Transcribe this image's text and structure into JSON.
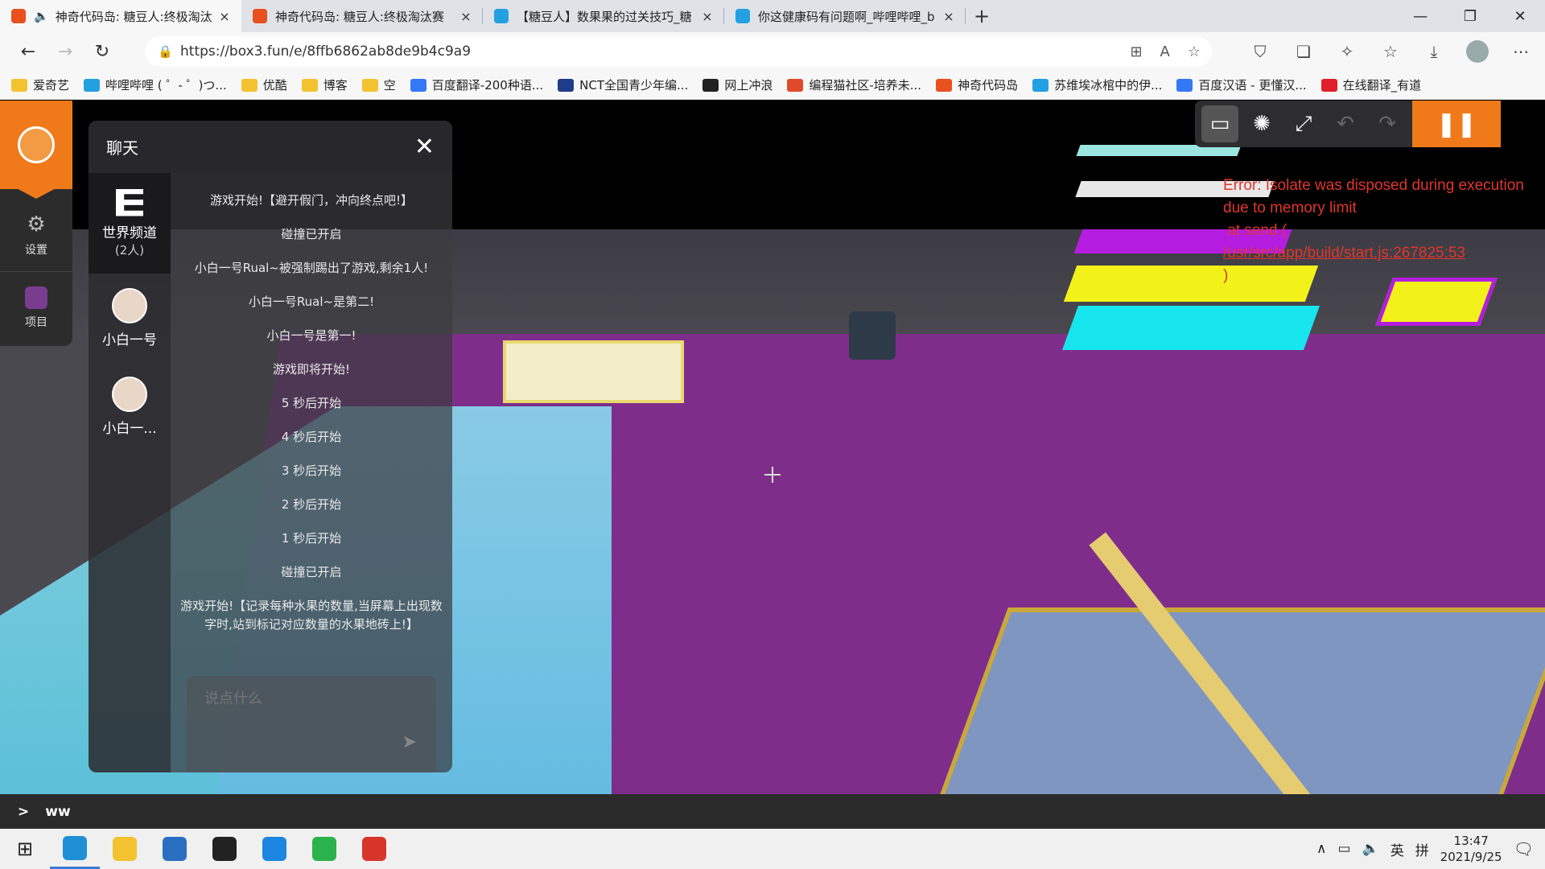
{
  "tabs": [
    {
      "title": "神奇代码岛: 糖豆人:终极淘汰",
      "close": "×",
      "fav_color": "#e8501e",
      "active": true
    },
    {
      "title": "神奇代码岛: 糖豆人:终极淘汰赛",
      "close": "×",
      "fav_color": "#e8501e"
    },
    {
      "title": "【糖豆人】数果果的过关技巧_糖",
      "close": "×",
      "fav_color": "#23a0e0"
    },
    {
      "title": "你这健康码有问题啊_哔哩哔哩_b",
      "close": "×",
      "fav_color": "#23a0e0"
    }
  ],
  "new_tab": "+",
  "address": {
    "url": "https://box3.fun/e/8ffb6862ab8de9b4c9a9"
  },
  "bookmarks": [
    {
      "label": "爱奇艺",
      "color": "#f2c230"
    },
    {
      "label": "哔哩哔哩 ( ゜- ゜)つ...",
      "color": "#23a0e0"
    },
    {
      "label": "优酷",
      "color": "#f2c230"
    },
    {
      "label": "博客",
      "color": "#f2c230"
    },
    {
      "label": "空",
      "color": "#f2c230"
    },
    {
      "label": "百度翻译-200种语...",
      "color": "#3478f6"
    },
    {
      "label": "NCT全国青少年编...",
      "color": "#1f3c8a"
    },
    {
      "label": "网上冲浪",
      "color": "#222222"
    },
    {
      "label": "编程猫社区-培养未...",
      "color": "#e04a2a"
    },
    {
      "label": "神奇代码岛",
      "color": "#e8501e"
    },
    {
      "label": "苏维埃冰棺中的伊...",
      "color": "#23a0e0"
    },
    {
      "label": "百度汉语 - 更懂汉...",
      "color": "#3478f6"
    },
    {
      "label": "在线翻译_有道",
      "color": "#e0202a"
    }
  ],
  "sidenav": {
    "settings_label": "设置",
    "project_label": "项目"
  },
  "chat": {
    "title": "聊天",
    "close": "✕",
    "channels": [
      {
        "name": "世界频道",
        "sub": "(2人)"
      },
      {
        "name": "小白一号"
      },
      {
        "name": "小白一..."
      }
    ],
    "messages": [
      "游戏开始!【避开假门，冲向终点吧!】",
      "碰撞已开启",
      "小白一号Rual~被强制踢出了游戏,剩余1人!",
      "小白一号Rual~是第二!",
      "小白一号是第一!",
      "游戏即将开始!",
      "5 秒后开始",
      "4 秒后开始",
      "3 秒后开始",
      "2 秒后开始",
      "1 秒后开始",
      "碰撞已开启",
      "游戏开始!【记录每种水果的数量,当屏幕上出现数字时,站到标记对应数量的水果地砖上!】"
    ],
    "input_placeholder": "说点什么"
  },
  "error": {
    "line1": "Error: Isolate was disposed during execution due to memory limit",
    "line2": "at send (",
    "link": "/usr/src/app/build/start.js:267825:53",
    "line3": ")"
  },
  "console": {
    "prompt": ">",
    "text": "ww"
  },
  "taskbar": {
    "apps": [
      {
        "name": "edge",
        "color": "#1f8fd6"
      },
      {
        "name": "explorer",
        "color": "#f2c230"
      },
      {
        "name": "photos",
        "color": "#2a6fbf"
      },
      {
        "name": "qq",
        "color": "#222222"
      },
      {
        "name": "kugou",
        "color": "#1c86e0"
      },
      {
        "name": "wechat",
        "color": "#2bb24c"
      },
      {
        "name": "wps",
        "color": "#d8352a"
      }
    ],
    "ime": "英",
    "ime2": "拼",
    "time": "13:47",
    "date": "2021/9/25"
  }
}
